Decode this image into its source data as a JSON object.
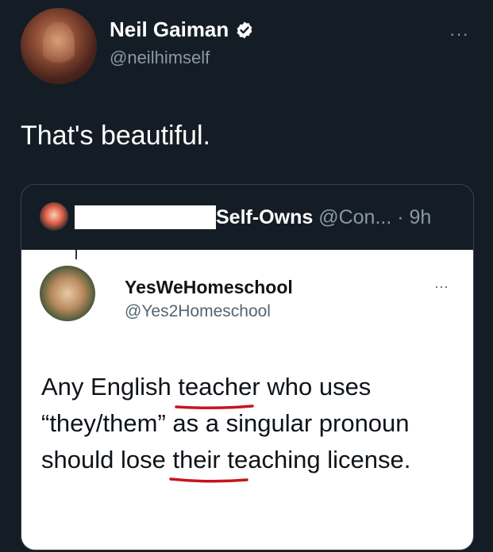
{
  "tweet": {
    "name": "Neil Gaiman",
    "handle": "@neilhimself",
    "text": "That's beautiful.",
    "more": "···"
  },
  "quote": {
    "account_name": "Self-Owns",
    "meta": "@Con... · 9h",
    "card": {
      "name": "YesWeHomeschool",
      "handle": "@Yes2Homeschool",
      "more": "···",
      "text_parts": {
        "p1": "Any English ",
        "w1": "teacher",
        "p2": " who uses “they/them” as a singular pronoun should lose ",
        "w2": "their",
        "p3": " teaching license."
      }
    }
  },
  "colors": {
    "background": "#141d26",
    "verified_badge": "#ffffff",
    "underline": "#c8141e"
  }
}
